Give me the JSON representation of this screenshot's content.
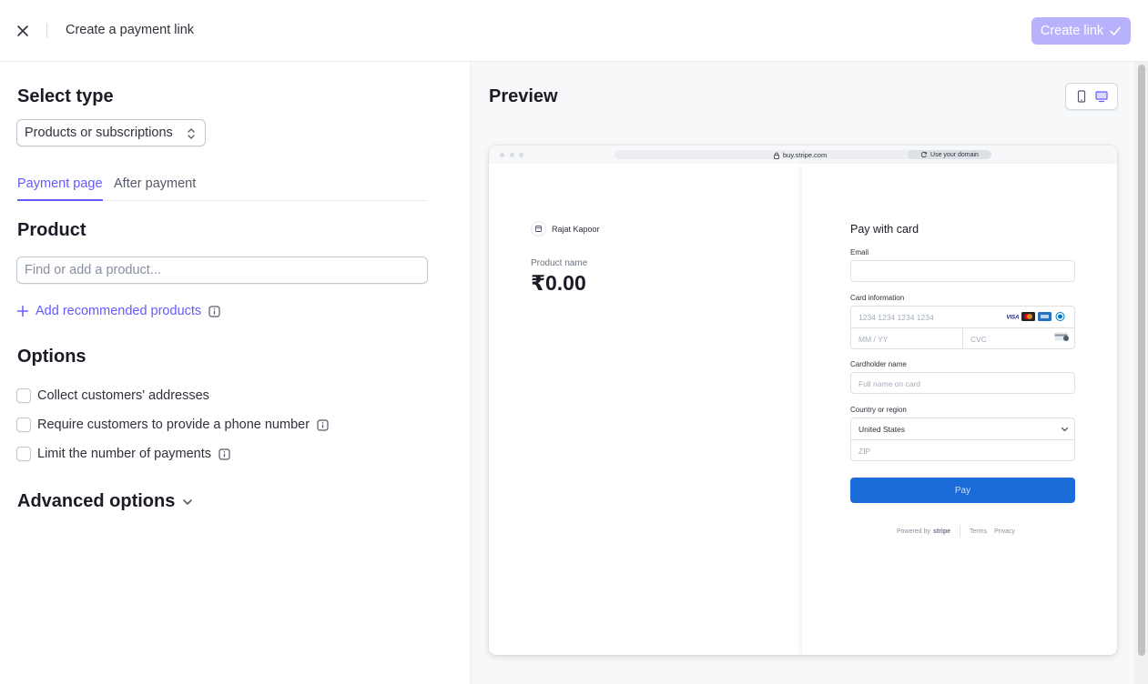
{
  "header": {
    "title": "Create a payment link",
    "create_button": "Create link"
  },
  "left": {
    "select_type_title": "Select type",
    "select_type_value": "Products or subscriptions",
    "tabs": [
      {
        "label": "Payment page",
        "active": true
      },
      {
        "label": "After payment",
        "active": false
      }
    ],
    "product_title": "Product",
    "product_placeholder": "Find or add a product...",
    "add_recommended": "Add recommended products",
    "options_title": "Options",
    "options": [
      {
        "label": "Collect customers' addresses",
        "checked": false,
        "info": false
      },
      {
        "label": "Require customers to provide a phone number",
        "checked": false,
        "info": true
      },
      {
        "label": "Limit the number of payments",
        "checked": false,
        "info": true
      }
    ],
    "advanced_title": "Advanced options"
  },
  "preview": {
    "title": "Preview",
    "url": "buy.stripe.com",
    "use_domain": "Use your domain",
    "merchant_name": "Rajat Kapoor",
    "product_name": "Product name",
    "price": "₹0.00",
    "pay_title": "Pay with card",
    "email_label": "Email",
    "card_label": "Card information",
    "card_number_placeholder": "1234 1234 1234 1234",
    "expiry_placeholder": "MM / YY",
    "cvc_placeholder": "CVC",
    "cardholder_label": "Cardholder name",
    "cardholder_placeholder": "Full name on card",
    "country_label": "Country or region",
    "country_value": "United States",
    "zip_placeholder": "ZIP",
    "pay_button": "Pay",
    "powered_by": "Powered by",
    "powered_brand": "stripe",
    "terms": "Terms",
    "privacy": "Privacy"
  },
  "colors": {
    "accent": "#635bff",
    "accent_disabled": "#b7b2fb",
    "pay_button": "#1b6bd9"
  }
}
